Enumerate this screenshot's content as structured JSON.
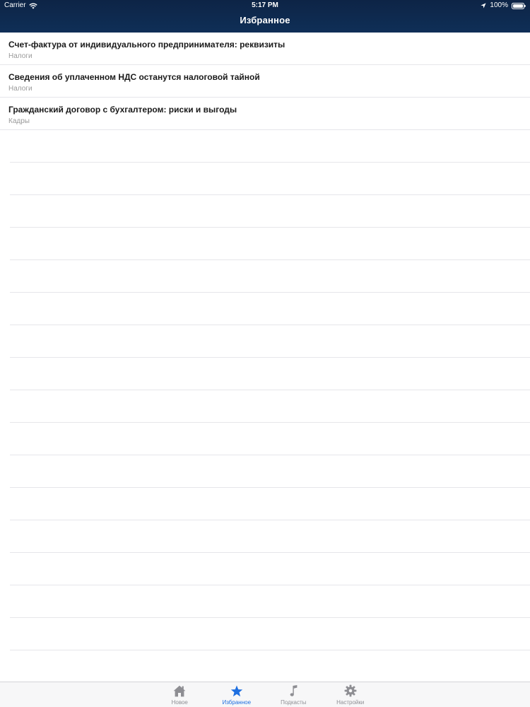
{
  "status_bar": {
    "carrier": "Carrier",
    "time": "5:17 PM",
    "battery": "100%"
  },
  "nav": {
    "title": "Избранное"
  },
  "list": {
    "items": [
      {
        "title": "Счет-фактура от индивидуального предпринимателя: реквизиты",
        "category": "Налоги"
      },
      {
        "title": "Сведения об уплаченном НДС останутся налоговой тайной",
        "category": "Налоги"
      },
      {
        "title": "Гражданский договор с бухгалтером: риски  и выгоды",
        "category": "Кадры"
      }
    ]
  },
  "tabbar": {
    "tabs": [
      {
        "label": "Новое",
        "icon": "home-icon",
        "active": false
      },
      {
        "label": "Избранное",
        "icon": "star-icon",
        "active": true
      },
      {
        "label": "Подкасты",
        "icon": "music-note-icon",
        "active": false
      },
      {
        "label": "Настройки",
        "icon": "gear-icon",
        "active": false
      }
    ]
  },
  "colors": {
    "nav_background": "#0f2f57",
    "accent": "#1e6fe0",
    "inactive_tab": "#8e8e93",
    "subtitle": "#9a9a9a"
  }
}
